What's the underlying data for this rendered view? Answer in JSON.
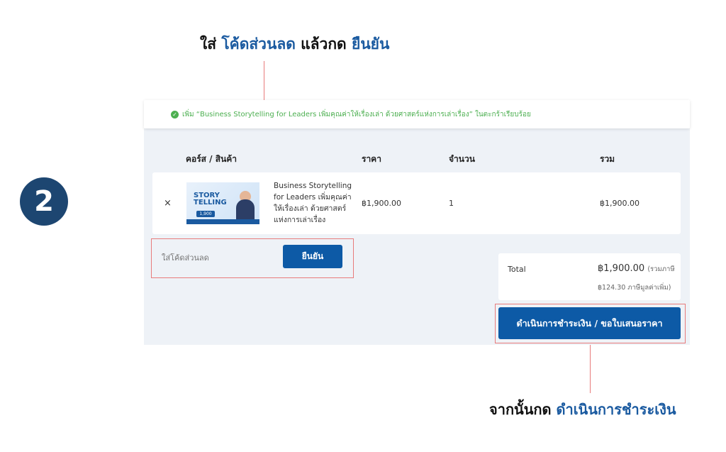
{
  "top_instruction": {
    "prefix": "ใส่",
    "coupon": "โค้ดส่วนลด",
    "middle": "แล้วกด",
    "confirm": "ยืนยัน"
  },
  "step_number": "2",
  "notice": {
    "text": "เพิ่ม “Business Storytelling for Leaders เพิ่มคุณค่าให้เรื่องเล่า ด้วยศาสตร์แห่งการเล่าเรื่อง” ในตะกร้าเรียบร้อย"
  },
  "table": {
    "headers": {
      "product": "คอร์ส / สินค้า",
      "price": "ราคา",
      "quantity": "จำนวน",
      "total": "รวม"
    },
    "rows": [
      {
        "remove": "×",
        "thumbnail": {
          "title_lines": [
            "STORY",
            "TELLING"
          ],
          "price_badge": "1,900"
        },
        "name": "Business Storytelling for Leaders เพิ่มคุณค่าให้เรื่องเล่า ด้วยศาสตร์แห่งการเล่าเรื่อง",
        "price": "฿1,900.00",
        "quantity": "1",
        "subtotal": "฿1,900.00"
      }
    ]
  },
  "coupon": {
    "placeholder": "ใส่โค้ดส่วนลด",
    "button": "ยืนยัน"
  },
  "totals": {
    "label": "Total",
    "amount": "฿1,900.00",
    "tax_note_1": "(รวมภาษี",
    "tax_note_2": "฿124.30 ภาษีมูลค่าเพิ่ม)"
  },
  "checkout_button": "ดำเนินการชำระเงิน / ขอใบเสนอราคา",
  "bottom_instruction": {
    "prefix": "จากนั้นกด",
    "action": "ดำเนินการชำระเงิน"
  },
  "colors": {
    "primary": "#0d5aa6",
    "navy": "#1d4671",
    "success": "#4caf50",
    "annotation": "#e87b7b",
    "panel": "#eef2f7"
  }
}
